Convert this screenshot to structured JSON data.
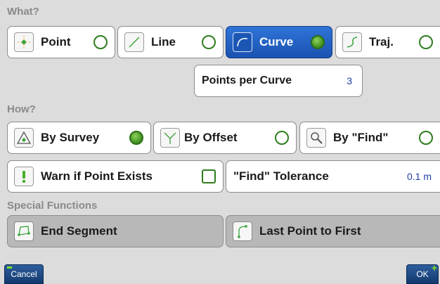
{
  "sections": {
    "what": "What?",
    "how": "How?",
    "special": "Special Functions"
  },
  "what_buttons": {
    "point": "Point",
    "line": "Line",
    "curve": "Curve",
    "traj": "Traj."
  },
  "points_per_curve": {
    "label": "Points per Curve",
    "value": "3"
  },
  "how_buttons": {
    "by_survey": "By Survey",
    "by_offset": "By Offset",
    "by_find": "By \"Find\""
  },
  "warn_if_point_exists": {
    "label": "Warn if Point Exists",
    "checked": false
  },
  "find_tolerance": {
    "label": "\"Find\" Tolerance",
    "value": "0.1 m"
  },
  "special_buttons": {
    "end_segment": "End Segment",
    "last_point_to_first": "Last Point to First"
  },
  "footer": {
    "cancel": "Cancel",
    "ok": "OK"
  },
  "selected": {
    "what": "curve",
    "how": "by_survey"
  },
  "colors": {
    "accent": "#1f5fc7",
    "radio": "#3f8f1f",
    "value": "#1f3fa8"
  }
}
